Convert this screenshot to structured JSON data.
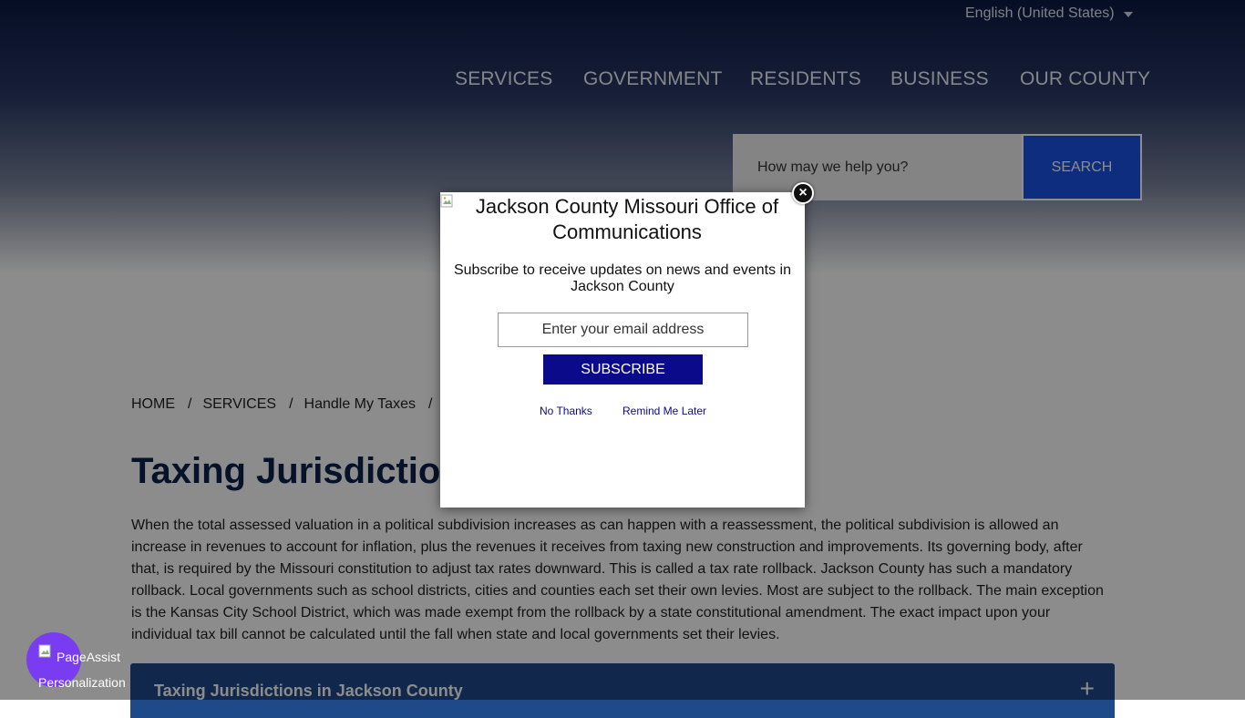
{
  "header": {
    "language": "English (United States)",
    "nav": [
      "SERVICES",
      "GOVERNMENT",
      "RESIDENTS",
      "BUSINESS",
      "OUR COUNTY"
    ],
    "search": {
      "placeholder": "How may we help you?",
      "button": "SEARCH"
    }
  },
  "breadcrumb": [
    "HOME",
    "SERVICES",
    "Handle My Taxes"
  ],
  "main": {
    "title": "Taxing Jurisdictions",
    "paragraph": "When the total assessed valuation in a political subdivision increases as can happen with a reassessment, the political subdivision is allowed an increase in revenues to account for inflation, plus the revenues it receives from taxing new construction and improvements. Its governing body, after that, is required by the Missouri constitution to adjust tax rates downward. This is called a tax rate rollback. Jackson County has such a mandatory rollback. Local governments such as school districts, cities and counties each set their own levies. Most are subject to the rollback. The main exception is the Kansas City School District, which was made exempt from the rollback by a state constitutional amendment. The exact impact upon your individual tax bill cannot be calculated until the fall when state and local governments set their levies.",
    "accordion_label": "Taxing Jurisdictions in Jackson County"
  },
  "modal": {
    "logo_alt": "Jackson County Missouri Office of Communications",
    "subscribe_text": "Subscribe to receive updates on news and events in Jackson County",
    "email_placeholder": "Enter your email address",
    "subscribe_button": "SUBSCRIBE",
    "no_thanks": "No Thanks",
    "remind_later": "Remind Me Later"
  },
  "page_assist": {
    "label1": "PageAssist",
    "label2": "Personalization"
  },
  "colors": {
    "nav_bg": "#0b1a45",
    "search_button": "#1b52e6",
    "subscribe_button": "#0a0a8a",
    "accordion": "#1f4a8a",
    "page_assist": "#7a3cf0"
  }
}
